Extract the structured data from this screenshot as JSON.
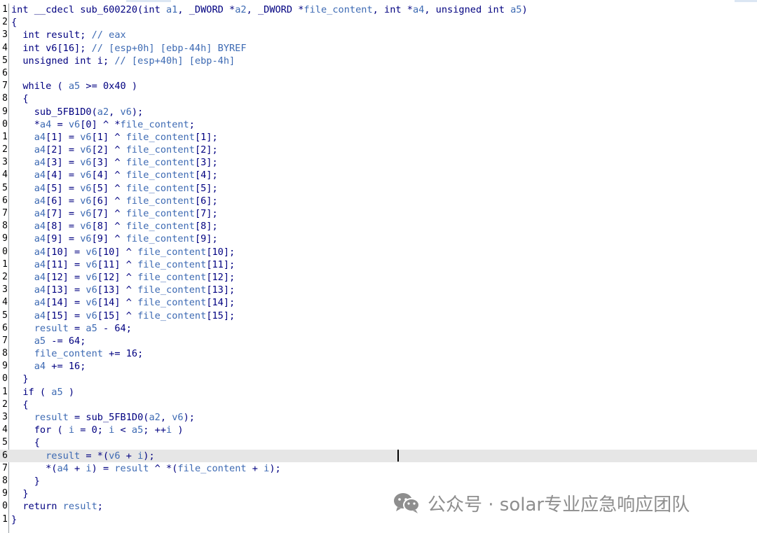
{
  "editor": {
    "lines": [
      {
        "num": "1",
        "highlight": false,
        "tokens": [
          {
            "t": "int __cdecl sub_600220(int ",
            "c": "kw"
          },
          {
            "t": "a1",
            "c": "var"
          },
          {
            "t": ", _DWORD *",
            "c": "kw"
          },
          {
            "t": "a2",
            "c": "var"
          },
          {
            "t": ", _DWORD *",
            "c": "kw"
          },
          {
            "t": "file_content",
            "c": "var"
          },
          {
            "t": ", int *",
            "c": "kw"
          },
          {
            "t": "a4",
            "c": "var"
          },
          {
            "t": ", unsigned int ",
            "c": "kw"
          },
          {
            "t": "a5",
            "c": "var"
          },
          {
            "t": ")",
            "c": "kw"
          }
        ]
      },
      {
        "num": "2",
        "highlight": false,
        "tokens": [
          {
            "t": "{",
            "c": "pl"
          }
        ]
      },
      {
        "num": "3",
        "highlight": false,
        "tokens": [
          {
            "t": "  int result; ",
            "c": "kw"
          },
          {
            "t": "// eax",
            "c": "cm"
          }
        ]
      },
      {
        "num": "4",
        "highlight": false,
        "tokens": [
          {
            "t": "  int v6[16]; ",
            "c": "kw"
          },
          {
            "t": "// [esp+0h] [ebp-44h] BYREF",
            "c": "cm"
          }
        ]
      },
      {
        "num": "5",
        "highlight": false,
        "tokens": [
          {
            "t": "  unsigned int i; ",
            "c": "kw"
          },
          {
            "t": "// [esp+40h] [ebp-4h]",
            "c": "cm"
          }
        ]
      },
      {
        "num": "6",
        "highlight": false,
        "tokens": [
          {
            "t": "",
            "c": "pl"
          }
        ]
      },
      {
        "num": "7",
        "highlight": false,
        "tokens": [
          {
            "t": "  while ( ",
            "c": "kw"
          },
          {
            "t": "a5",
            "c": "var"
          },
          {
            "t": " >= 0x40 )",
            "c": "kw"
          }
        ]
      },
      {
        "num": "8",
        "highlight": false,
        "tokens": [
          {
            "t": "  {",
            "c": "pl"
          }
        ]
      },
      {
        "num": "9",
        "highlight": false,
        "tokens": [
          {
            "t": "    sub_5FB1D0(",
            "c": "kw"
          },
          {
            "t": "a2",
            "c": "var"
          },
          {
            "t": ", ",
            "c": "kw"
          },
          {
            "t": "v6",
            "c": "var"
          },
          {
            "t": ");",
            "c": "kw"
          }
        ]
      },
      {
        "num": "0",
        "highlight": false,
        "tokens": [
          {
            "t": "    *",
            "c": "kw"
          },
          {
            "t": "a4",
            "c": "var"
          },
          {
            "t": " = ",
            "c": "kw"
          },
          {
            "t": "v6",
            "c": "var"
          },
          {
            "t": "[0] ^ *",
            "c": "kw"
          },
          {
            "t": "file_content",
            "c": "var"
          },
          {
            "t": ";",
            "c": "kw"
          }
        ]
      },
      {
        "num": "1",
        "highlight": false,
        "tokens": [
          {
            "t": "    ",
            "c": "kw"
          },
          {
            "t": "a4",
            "c": "var"
          },
          {
            "t": "[1] = ",
            "c": "kw"
          },
          {
            "t": "v6",
            "c": "var"
          },
          {
            "t": "[1] ^ ",
            "c": "kw"
          },
          {
            "t": "file_content",
            "c": "var"
          },
          {
            "t": "[1];",
            "c": "kw"
          }
        ]
      },
      {
        "num": "2",
        "highlight": false,
        "tokens": [
          {
            "t": "    ",
            "c": "kw"
          },
          {
            "t": "a4",
            "c": "var"
          },
          {
            "t": "[2] = ",
            "c": "kw"
          },
          {
            "t": "v6",
            "c": "var"
          },
          {
            "t": "[2] ^ ",
            "c": "kw"
          },
          {
            "t": "file_content",
            "c": "var"
          },
          {
            "t": "[2];",
            "c": "kw"
          }
        ]
      },
      {
        "num": "3",
        "highlight": false,
        "tokens": [
          {
            "t": "    ",
            "c": "kw"
          },
          {
            "t": "a4",
            "c": "var"
          },
          {
            "t": "[3] = ",
            "c": "kw"
          },
          {
            "t": "v6",
            "c": "var"
          },
          {
            "t": "[3] ^ ",
            "c": "kw"
          },
          {
            "t": "file_content",
            "c": "var"
          },
          {
            "t": "[3];",
            "c": "kw"
          }
        ]
      },
      {
        "num": "4",
        "highlight": false,
        "tokens": [
          {
            "t": "    ",
            "c": "kw"
          },
          {
            "t": "a4",
            "c": "var"
          },
          {
            "t": "[4] = ",
            "c": "kw"
          },
          {
            "t": "v6",
            "c": "var"
          },
          {
            "t": "[4] ^ ",
            "c": "kw"
          },
          {
            "t": "file_content",
            "c": "var"
          },
          {
            "t": "[4];",
            "c": "kw"
          }
        ]
      },
      {
        "num": "5",
        "highlight": false,
        "tokens": [
          {
            "t": "    ",
            "c": "kw"
          },
          {
            "t": "a4",
            "c": "var"
          },
          {
            "t": "[5] = ",
            "c": "kw"
          },
          {
            "t": "v6",
            "c": "var"
          },
          {
            "t": "[5] ^ ",
            "c": "kw"
          },
          {
            "t": "file_content",
            "c": "var"
          },
          {
            "t": "[5];",
            "c": "kw"
          }
        ]
      },
      {
        "num": "6",
        "highlight": false,
        "tokens": [
          {
            "t": "    ",
            "c": "kw"
          },
          {
            "t": "a4",
            "c": "var"
          },
          {
            "t": "[6] = ",
            "c": "kw"
          },
          {
            "t": "v6",
            "c": "var"
          },
          {
            "t": "[6] ^ ",
            "c": "kw"
          },
          {
            "t": "file_content",
            "c": "var"
          },
          {
            "t": "[6];",
            "c": "kw"
          }
        ]
      },
      {
        "num": "7",
        "highlight": false,
        "tokens": [
          {
            "t": "    ",
            "c": "kw"
          },
          {
            "t": "a4",
            "c": "var"
          },
          {
            "t": "[7] = ",
            "c": "kw"
          },
          {
            "t": "v6",
            "c": "var"
          },
          {
            "t": "[7] ^ ",
            "c": "kw"
          },
          {
            "t": "file_content",
            "c": "var"
          },
          {
            "t": "[7];",
            "c": "kw"
          }
        ]
      },
      {
        "num": "8",
        "highlight": false,
        "tokens": [
          {
            "t": "    ",
            "c": "kw"
          },
          {
            "t": "a4",
            "c": "var"
          },
          {
            "t": "[8] = ",
            "c": "kw"
          },
          {
            "t": "v6",
            "c": "var"
          },
          {
            "t": "[8] ^ ",
            "c": "kw"
          },
          {
            "t": "file_content",
            "c": "var"
          },
          {
            "t": "[8];",
            "c": "kw"
          }
        ]
      },
      {
        "num": "9",
        "highlight": false,
        "tokens": [
          {
            "t": "    ",
            "c": "kw"
          },
          {
            "t": "a4",
            "c": "var"
          },
          {
            "t": "[9] = ",
            "c": "kw"
          },
          {
            "t": "v6",
            "c": "var"
          },
          {
            "t": "[9] ^ ",
            "c": "kw"
          },
          {
            "t": "file_content",
            "c": "var"
          },
          {
            "t": "[9];",
            "c": "kw"
          }
        ]
      },
      {
        "num": "0",
        "highlight": false,
        "tokens": [
          {
            "t": "    ",
            "c": "kw"
          },
          {
            "t": "a4",
            "c": "var"
          },
          {
            "t": "[10] = ",
            "c": "kw"
          },
          {
            "t": "v6",
            "c": "var"
          },
          {
            "t": "[10] ^ ",
            "c": "kw"
          },
          {
            "t": "file_content",
            "c": "var"
          },
          {
            "t": "[10];",
            "c": "kw"
          }
        ]
      },
      {
        "num": "1",
        "highlight": false,
        "tokens": [
          {
            "t": "    ",
            "c": "kw"
          },
          {
            "t": "a4",
            "c": "var"
          },
          {
            "t": "[11] = ",
            "c": "kw"
          },
          {
            "t": "v6",
            "c": "var"
          },
          {
            "t": "[11] ^ ",
            "c": "kw"
          },
          {
            "t": "file_content",
            "c": "var"
          },
          {
            "t": "[11];",
            "c": "kw"
          }
        ]
      },
      {
        "num": "2",
        "highlight": false,
        "tokens": [
          {
            "t": "    ",
            "c": "kw"
          },
          {
            "t": "a4",
            "c": "var"
          },
          {
            "t": "[12] = ",
            "c": "kw"
          },
          {
            "t": "v6",
            "c": "var"
          },
          {
            "t": "[12] ^ ",
            "c": "kw"
          },
          {
            "t": "file_content",
            "c": "var"
          },
          {
            "t": "[12];",
            "c": "kw"
          }
        ]
      },
      {
        "num": "3",
        "highlight": false,
        "tokens": [
          {
            "t": "    ",
            "c": "kw"
          },
          {
            "t": "a4",
            "c": "var"
          },
          {
            "t": "[13] = ",
            "c": "kw"
          },
          {
            "t": "v6",
            "c": "var"
          },
          {
            "t": "[13] ^ ",
            "c": "kw"
          },
          {
            "t": "file_content",
            "c": "var"
          },
          {
            "t": "[13];",
            "c": "kw"
          }
        ]
      },
      {
        "num": "4",
        "highlight": false,
        "tokens": [
          {
            "t": "    ",
            "c": "kw"
          },
          {
            "t": "a4",
            "c": "var"
          },
          {
            "t": "[14] = ",
            "c": "kw"
          },
          {
            "t": "v6",
            "c": "var"
          },
          {
            "t": "[14] ^ ",
            "c": "kw"
          },
          {
            "t": "file_content",
            "c": "var"
          },
          {
            "t": "[14];",
            "c": "kw"
          }
        ]
      },
      {
        "num": "5",
        "highlight": false,
        "tokens": [
          {
            "t": "    ",
            "c": "kw"
          },
          {
            "t": "a4",
            "c": "var"
          },
          {
            "t": "[15] = ",
            "c": "kw"
          },
          {
            "t": "v6",
            "c": "var"
          },
          {
            "t": "[15] ^ ",
            "c": "kw"
          },
          {
            "t": "file_content",
            "c": "var"
          },
          {
            "t": "[15];",
            "c": "kw"
          }
        ]
      },
      {
        "num": "6",
        "highlight": false,
        "tokens": [
          {
            "t": "    ",
            "c": "kw"
          },
          {
            "t": "result",
            "c": "var"
          },
          {
            "t": " = ",
            "c": "kw"
          },
          {
            "t": "a5",
            "c": "var"
          },
          {
            "t": " - 64;",
            "c": "kw"
          }
        ]
      },
      {
        "num": "7",
        "highlight": false,
        "tokens": [
          {
            "t": "    ",
            "c": "kw"
          },
          {
            "t": "a5",
            "c": "var"
          },
          {
            "t": " -= 64;",
            "c": "kw"
          }
        ]
      },
      {
        "num": "8",
        "highlight": false,
        "tokens": [
          {
            "t": "    ",
            "c": "kw"
          },
          {
            "t": "file_content",
            "c": "var"
          },
          {
            "t": " += 16;",
            "c": "kw"
          }
        ]
      },
      {
        "num": "9",
        "highlight": false,
        "tokens": [
          {
            "t": "    ",
            "c": "kw"
          },
          {
            "t": "a4",
            "c": "var"
          },
          {
            "t": " += 16;",
            "c": "kw"
          }
        ]
      },
      {
        "num": "0",
        "highlight": false,
        "tokens": [
          {
            "t": "  }",
            "c": "pl"
          }
        ]
      },
      {
        "num": "1",
        "highlight": false,
        "tokens": [
          {
            "t": "  if ( ",
            "c": "kw"
          },
          {
            "t": "a5",
            "c": "var"
          },
          {
            "t": " )",
            "c": "kw"
          }
        ]
      },
      {
        "num": "2",
        "highlight": false,
        "tokens": [
          {
            "t": "  {",
            "c": "pl"
          }
        ]
      },
      {
        "num": "3",
        "highlight": false,
        "tokens": [
          {
            "t": "    ",
            "c": "kw"
          },
          {
            "t": "result",
            "c": "var"
          },
          {
            "t": " = sub_5FB1D0(",
            "c": "kw"
          },
          {
            "t": "a2",
            "c": "var"
          },
          {
            "t": ", ",
            "c": "kw"
          },
          {
            "t": "v6",
            "c": "var"
          },
          {
            "t": ");",
            "c": "kw"
          }
        ]
      },
      {
        "num": "4",
        "highlight": false,
        "tokens": [
          {
            "t": "    for ( ",
            "c": "kw"
          },
          {
            "t": "i",
            "c": "var"
          },
          {
            "t": " = 0; ",
            "c": "kw"
          },
          {
            "t": "i",
            "c": "var"
          },
          {
            "t": " < ",
            "c": "kw"
          },
          {
            "t": "a5",
            "c": "var"
          },
          {
            "t": "; ++",
            "c": "kw"
          },
          {
            "t": "i",
            "c": "var"
          },
          {
            "t": " )",
            "c": "kw"
          }
        ]
      },
      {
        "num": "5",
        "highlight": false,
        "tokens": [
          {
            "t": "    {",
            "c": "pl"
          }
        ]
      },
      {
        "num": "6",
        "highlight": true,
        "tokens": [
          {
            "t": "      ",
            "c": "kw"
          },
          {
            "t": "result",
            "c": "var"
          },
          {
            "t": " = *(",
            "c": "kw"
          },
          {
            "t": "v6",
            "c": "var"
          },
          {
            "t": " + ",
            "c": "kw"
          },
          {
            "t": "i",
            "c": "var"
          },
          {
            "t": ");",
            "c": "kw"
          }
        ]
      },
      {
        "num": "7",
        "highlight": false,
        "tokens": [
          {
            "t": "      *(",
            "c": "kw"
          },
          {
            "t": "a4",
            "c": "var"
          },
          {
            "t": " + ",
            "c": "kw"
          },
          {
            "t": "i",
            "c": "var"
          },
          {
            "t": ") = ",
            "c": "kw"
          },
          {
            "t": "result",
            "c": "var"
          },
          {
            "t": " ^ *(",
            "c": "kw"
          },
          {
            "t": "file_content",
            "c": "var"
          },
          {
            "t": " + ",
            "c": "kw"
          },
          {
            "t": "i",
            "c": "var"
          },
          {
            "t": ");",
            "c": "kw"
          }
        ]
      },
      {
        "num": "8",
        "highlight": false,
        "tokens": [
          {
            "t": "    }",
            "c": "pl"
          }
        ]
      },
      {
        "num": "9",
        "highlight": false,
        "tokens": [
          {
            "t": "  }",
            "c": "pl"
          }
        ]
      },
      {
        "num": "0",
        "highlight": false,
        "tokens": [
          {
            "t": "  return ",
            "c": "kw"
          },
          {
            "t": "result",
            "c": "var"
          },
          {
            "t": ";",
            "c": "kw"
          }
        ]
      },
      {
        "num": "1",
        "highlight": false,
        "tokens": [
          {
            "t": "}",
            "c": "pl"
          }
        ]
      }
    ]
  },
  "watermark": {
    "text": "公众号 · solar专业应急响应团队",
    "icon": "wechat-icon"
  },
  "colors": {
    "keyword": "#000080",
    "variable": "#3d6ab3",
    "comment": "#3d6ab3",
    "highlight_line": "#e6e6e6",
    "watermark": "#8e8e8e"
  }
}
